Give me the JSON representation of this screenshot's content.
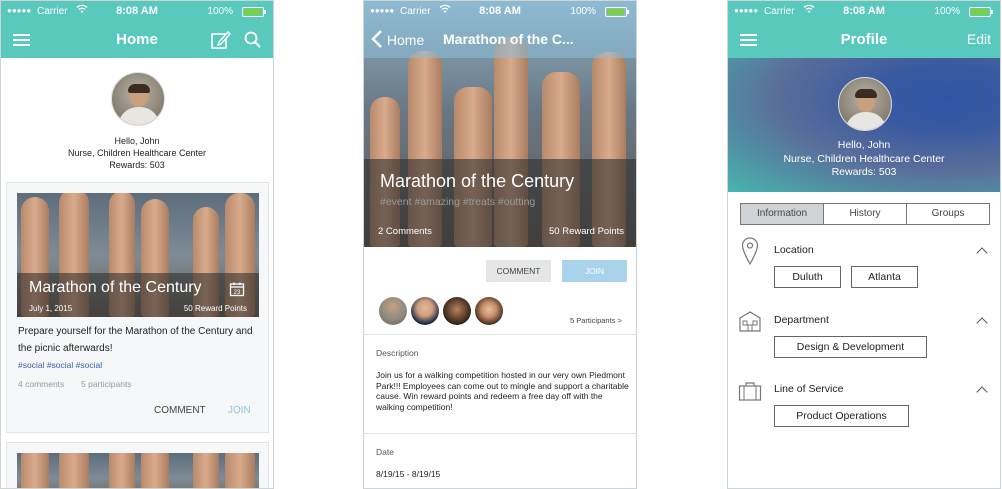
{
  "status": {
    "carrier": "Carrier",
    "time": "8:08 AM",
    "battery": "100%"
  },
  "home": {
    "title": "Home",
    "greeting": "Hello, John",
    "role": "Nurse, Children Healthcare Center",
    "rewards": "Rewards: 503",
    "card": {
      "title": "Marathon of the Century",
      "date": "July 1, 2015",
      "points": "50 Reward Points",
      "body": "Prepare yourself for the Marathon of the Century and the picnic afterwards!",
      "tags": "#social #social #social",
      "comments": "4 comments",
      "participants": "5 participants",
      "comment_btn": "COMMENT",
      "join_btn": "JOIN"
    }
  },
  "event": {
    "back_label": "Home",
    "nav_title": "Marathon of the C...",
    "title": "Marathon of the Century",
    "tags": "#event #amazing #treats #outting",
    "comments": "2 Comments",
    "points": "50 Reward Points",
    "comment_btn": "COMMENT",
    "join_btn": "JOIN",
    "participants_link": "5 Participants >",
    "description_label": "Description",
    "description": "Join us for a walking competition hosted in our very own Piedmont Park!!! Employees can come out to mingle and support a charitable cause. Win reward points and redeem a free day off with the walking competition!",
    "date_label": "Date",
    "date_value": "8/19/15 - 8/19/15"
  },
  "profile": {
    "title": "Profile",
    "edit": "Edit",
    "greeting": "Hello, John",
    "role": "Nurse, Children Healthcare Center",
    "rewards": "Rewards: 503",
    "tabs": [
      "Information",
      "History",
      "Groups"
    ],
    "location_label": "Location",
    "locations": [
      "Duluth",
      "Atlanta"
    ],
    "department_label": "Department",
    "department": "Design & Development",
    "los_label": "Line of Service",
    "los": "Product Operations"
  },
  "colors": {
    "teal": "#59c9bd",
    "join_blue": "#a9d3ea",
    "tag_blue": "#3a5fa8"
  }
}
